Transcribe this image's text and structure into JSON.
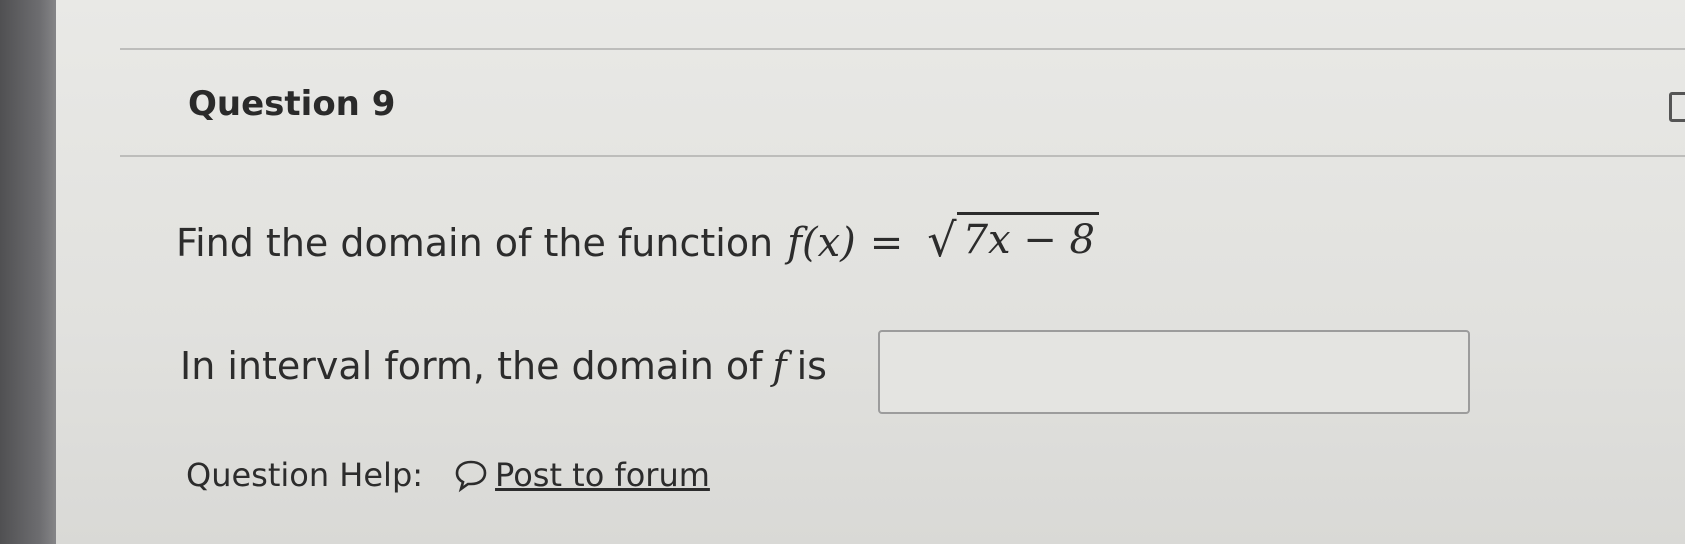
{
  "question": {
    "title": "Question 9",
    "prompt": "Find the domain of the function",
    "function": {
      "lhs": "f(x)",
      "equals": "=",
      "radical": "√",
      "radicand": "7x − 8"
    },
    "answer_prefix": "In interval form, the domain of",
    "answer_var": "f",
    "answer_suffix": "is",
    "answer_value": ""
  },
  "help": {
    "label": "Question Help:",
    "forum_link": "Post to forum",
    "forum_icon": "speech-bubble-icon"
  }
}
